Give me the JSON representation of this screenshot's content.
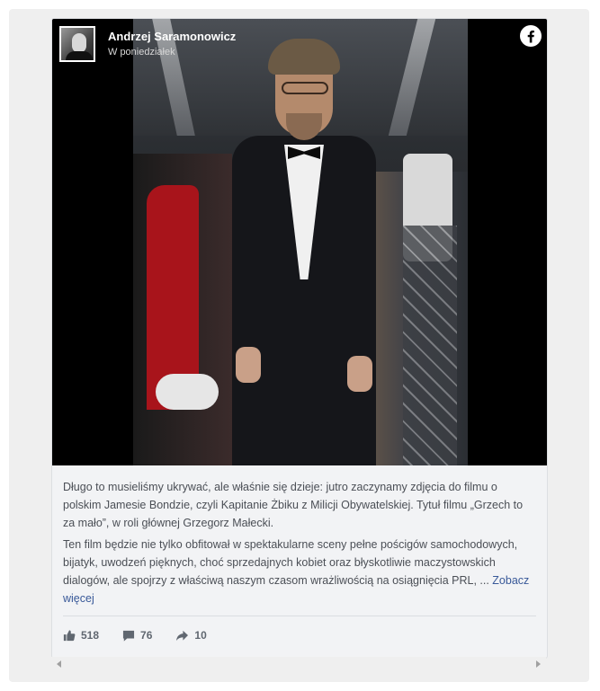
{
  "post": {
    "author_name": "Andrzej Saramonowicz",
    "timestamp": "W poniedziałek",
    "paragraph_1": "Długo to musieliśmy ukrywać, ale właśnie się dzieje: jutro zaczynamy zdjęcia do filmu o polskim Jamesie Bondzie, czyli Kapitanie Żbiku z Milicji Obywatelskiej. Tytuł filmu „Grzech to za mało”, w roli głównej Grzegorz Małecki.",
    "paragraph_2": "Ten film będzie nie tylko obfitował w spektakularne sceny pełne pościgów samochodowych, bijatyk, uwodzeń pięknych, choć sprzedajnych kobiet oraz błyskotliwie maczystowskich dialogów, ale spojrzy z właściwą naszym czasom wrażliwością na osiągnięcia PRL, ...",
    "see_more": "Zobacz więcej",
    "stats": {
      "likes": "518",
      "comments": "76",
      "shares": "10"
    }
  },
  "icons": {
    "brand": "facebook-icon",
    "like": "thumbs-up-icon",
    "comment": "comment-icon",
    "share": "share-arrow-icon"
  },
  "colors": {
    "link": "#385898",
    "text": "#4b4f56",
    "stats": "#606770",
    "card_bg": "#f2f3f5"
  }
}
